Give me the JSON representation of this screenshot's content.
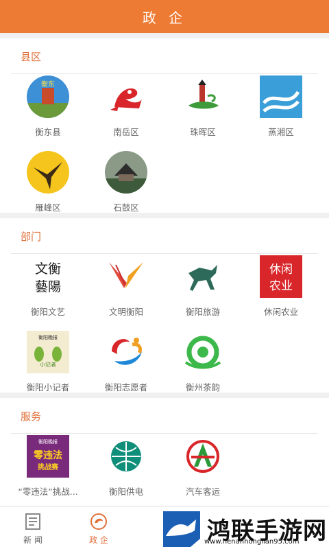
{
  "header": {
    "title": "政 企"
  },
  "sections": [
    {
      "title": "县区",
      "items": [
        "衡东县",
        "南岳区",
        "珠晖区",
        "蒸湘区",
        "雁峰区",
        "石鼓区"
      ]
    },
    {
      "title": "部门",
      "items": [
        "衡阳文艺",
        "文明衡阳",
        "衡阳旅游",
        "休闲农业",
        "衡阳小记者",
        "衡阳志愿者",
        "衡州茶韵"
      ]
    },
    {
      "title": "服务",
      "items": [
        "“零违法”挑战...",
        "衡阳供电",
        "汽车客运"
      ]
    }
  ],
  "icon_text": {
    "hengdong": "衡东",
    "wenyi_1": "文衡",
    "wenyi_2": "藝陽",
    "nongye_1": "休闲",
    "nongye_2": "农业",
    "jizhe": "衡阳晚报",
    "jizhe_sub": "小记者",
    "weifa_top": "衡阳晚报",
    "weifa_main": "零违法",
    "weifa_sub": "挑战赛"
  },
  "tabs": [
    {
      "label": "新 闻",
      "icon": "newspaper-icon",
      "active": false
    },
    {
      "label": "政 企",
      "icon": "gov-icon",
      "active": true
    }
  ],
  "promo": {
    "title": "鸿联手游网",
    "url": "www.henanhonglian95.com"
  },
  "colors": {
    "accent": "#ee7b33",
    "accent_text": "#e0703a",
    "promo_blue": "#1a5fb4"
  }
}
